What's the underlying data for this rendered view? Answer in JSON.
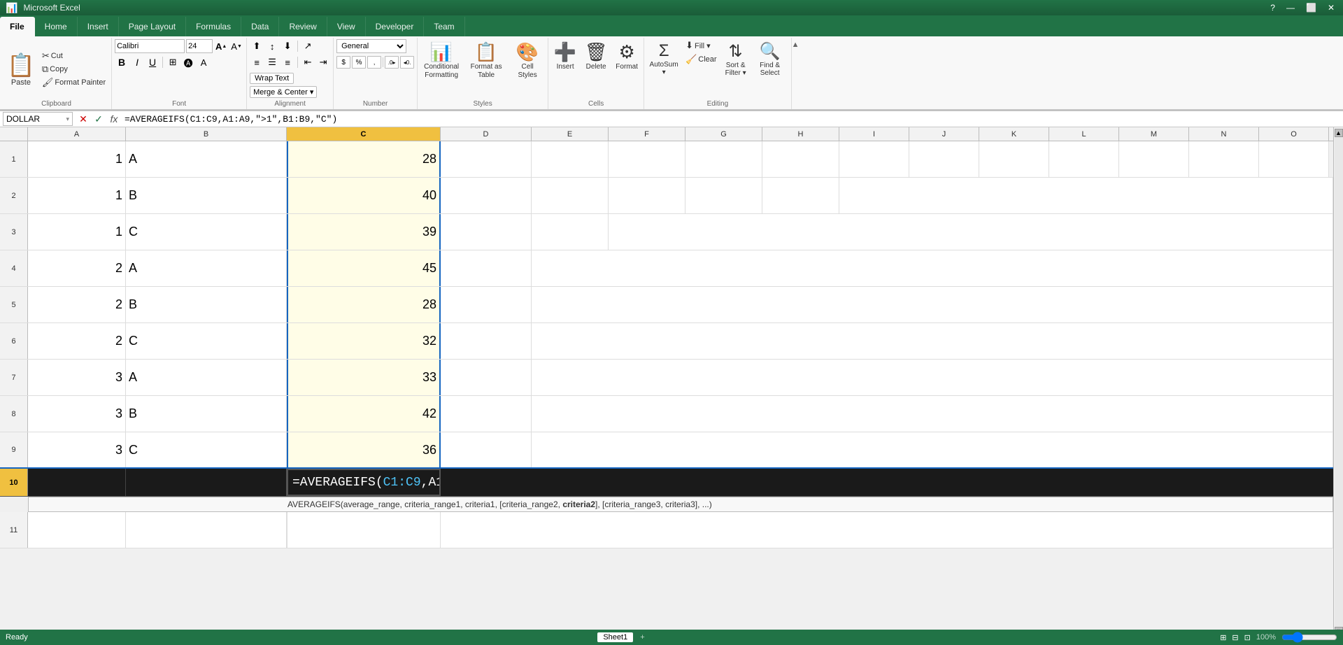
{
  "titlebar": {
    "title": "Microsoft Excel",
    "controls": [
      "?",
      "—",
      "⬜",
      "✕"
    ]
  },
  "tabs": [
    {
      "label": "File",
      "active": true
    },
    {
      "label": "Home",
      "active": false
    },
    {
      "label": "Insert",
      "active": false
    },
    {
      "label": "Page Layout",
      "active": false
    },
    {
      "label": "Formulas",
      "active": false
    },
    {
      "label": "Data",
      "active": false
    },
    {
      "label": "Review",
      "active": false
    },
    {
      "label": "View",
      "active": false
    },
    {
      "label": "Developer",
      "active": false
    },
    {
      "label": "Team",
      "active": false
    }
  ],
  "ribbon": {
    "clipboard": {
      "label": "Clipboard",
      "paste_label": "Paste",
      "cut_label": "Cut",
      "copy_label": "Copy",
      "format_painter_label": "Format Painter"
    },
    "font": {
      "label": "Font",
      "font_name": "Calibri",
      "font_size": "24",
      "bold": "B",
      "italic": "I",
      "underline": "U",
      "increase_size": "A▲",
      "decrease_size": "A▼"
    },
    "alignment": {
      "label": "Alignment",
      "wrap_text": "Wrap Text",
      "merge_center": "Merge & Center"
    },
    "number": {
      "label": "Number",
      "format": "General",
      "dollar": "$",
      "percent": "%",
      "comma": ",",
      "increase_decimal": ".0",
      "decrease_decimal": ".00"
    },
    "styles": {
      "label": "Styles",
      "conditional_formatting": "Conditional Formatting",
      "format_as_table": "Format as Table",
      "cell_styles": "Cell Styles"
    },
    "cells": {
      "label": "Cells",
      "insert": "Insert",
      "delete": "Delete",
      "format": "Format"
    },
    "editing": {
      "label": "Editing",
      "autosum": "AutoSum",
      "fill": "Fill",
      "clear": "Clear",
      "sort_filter": "Sort & Filter",
      "find_select": "Find & Select"
    }
  },
  "formula_bar": {
    "name_box": "DOLLAR",
    "cancel": "✕",
    "confirm": "✓",
    "function": "fx",
    "formula": "=AVERAGEIFS(C1:C9,A1:A9,\">1\",B1:B9,\"C\")"
  },
  "columns": [
    "A",
    "B",
    "C",
    "D",
    "E",
    "F",
    "G",
    "H",
    "I",
    "J",
    "K",
    "L",
    "M",
    "N",
    "O"
  ],
  "col_widths": {
    "A": 140,
    "B": 230,
    "C": 220,
    "D": 130,
    "E": 110,
    "F": 110,
    "G": 110,
    "H": 110,
    "I": 100,
    "J": 100,
    "K": 100,
    "L": 100,
    "M": 100,
    "N": 100,
    "O": 100
  },
  "selected_col": "C",
  "rows": [
    {
      "row": 1,
      "A": "1",
      "B": "A",
      "C": "28"
    },
    {
      "row": 2,
      "A": "1",
      "B": "B",
      "C": "40"
    },
    {
      "row": 3,
      "A": "1",
      "B": "C",
      "C": "39"
    },
    {
      "row": 4,
      "A": "2",
      "B": "A",
      "C": "45"
    },
    {
      "row": 5,
      "A": "2",
      "B": "B",
      "C": "28"
    },
    {
      "row": 6,
      "A": "2",
      "B": "C",
      "C": "32"
    },
    {
      "row": 7,
      "A": "3",
      "B": "A",
      "C": "33"
    },
    {
      "row": 8,
      "A": "3",
      "B": "B",
      "C": "42"
    },
    {
      "row": 9,
      "A": "3",
      "B": "C",
      "C": "36"
    }
  ],
  "row10": {
    "formula_text_prefix": "=AVERAGEIFS(",
    "formula_blue1": "C1:C9",
    "formula_comma1": ",",
    "formula_black1": "A1:A9",
    "formula_comma2": ",\">1\",",
    "formula_purple1": "B1:B9",
    "formula_comma3": ",",
    "formula_purple2": "\"C\"",
    "formula_suffix": ")"
  },
  "autocomplete": {
    "text": "AVERAGEIFS(average_range, criteria_range1, criteria1, [criteria_range2, ",
    "bold_part": "criteria2",
    "text2": "], [criteria_range3, criteria3], ...)"
  },
  "status_bar": {
    "text": "Ready"
  }
}
